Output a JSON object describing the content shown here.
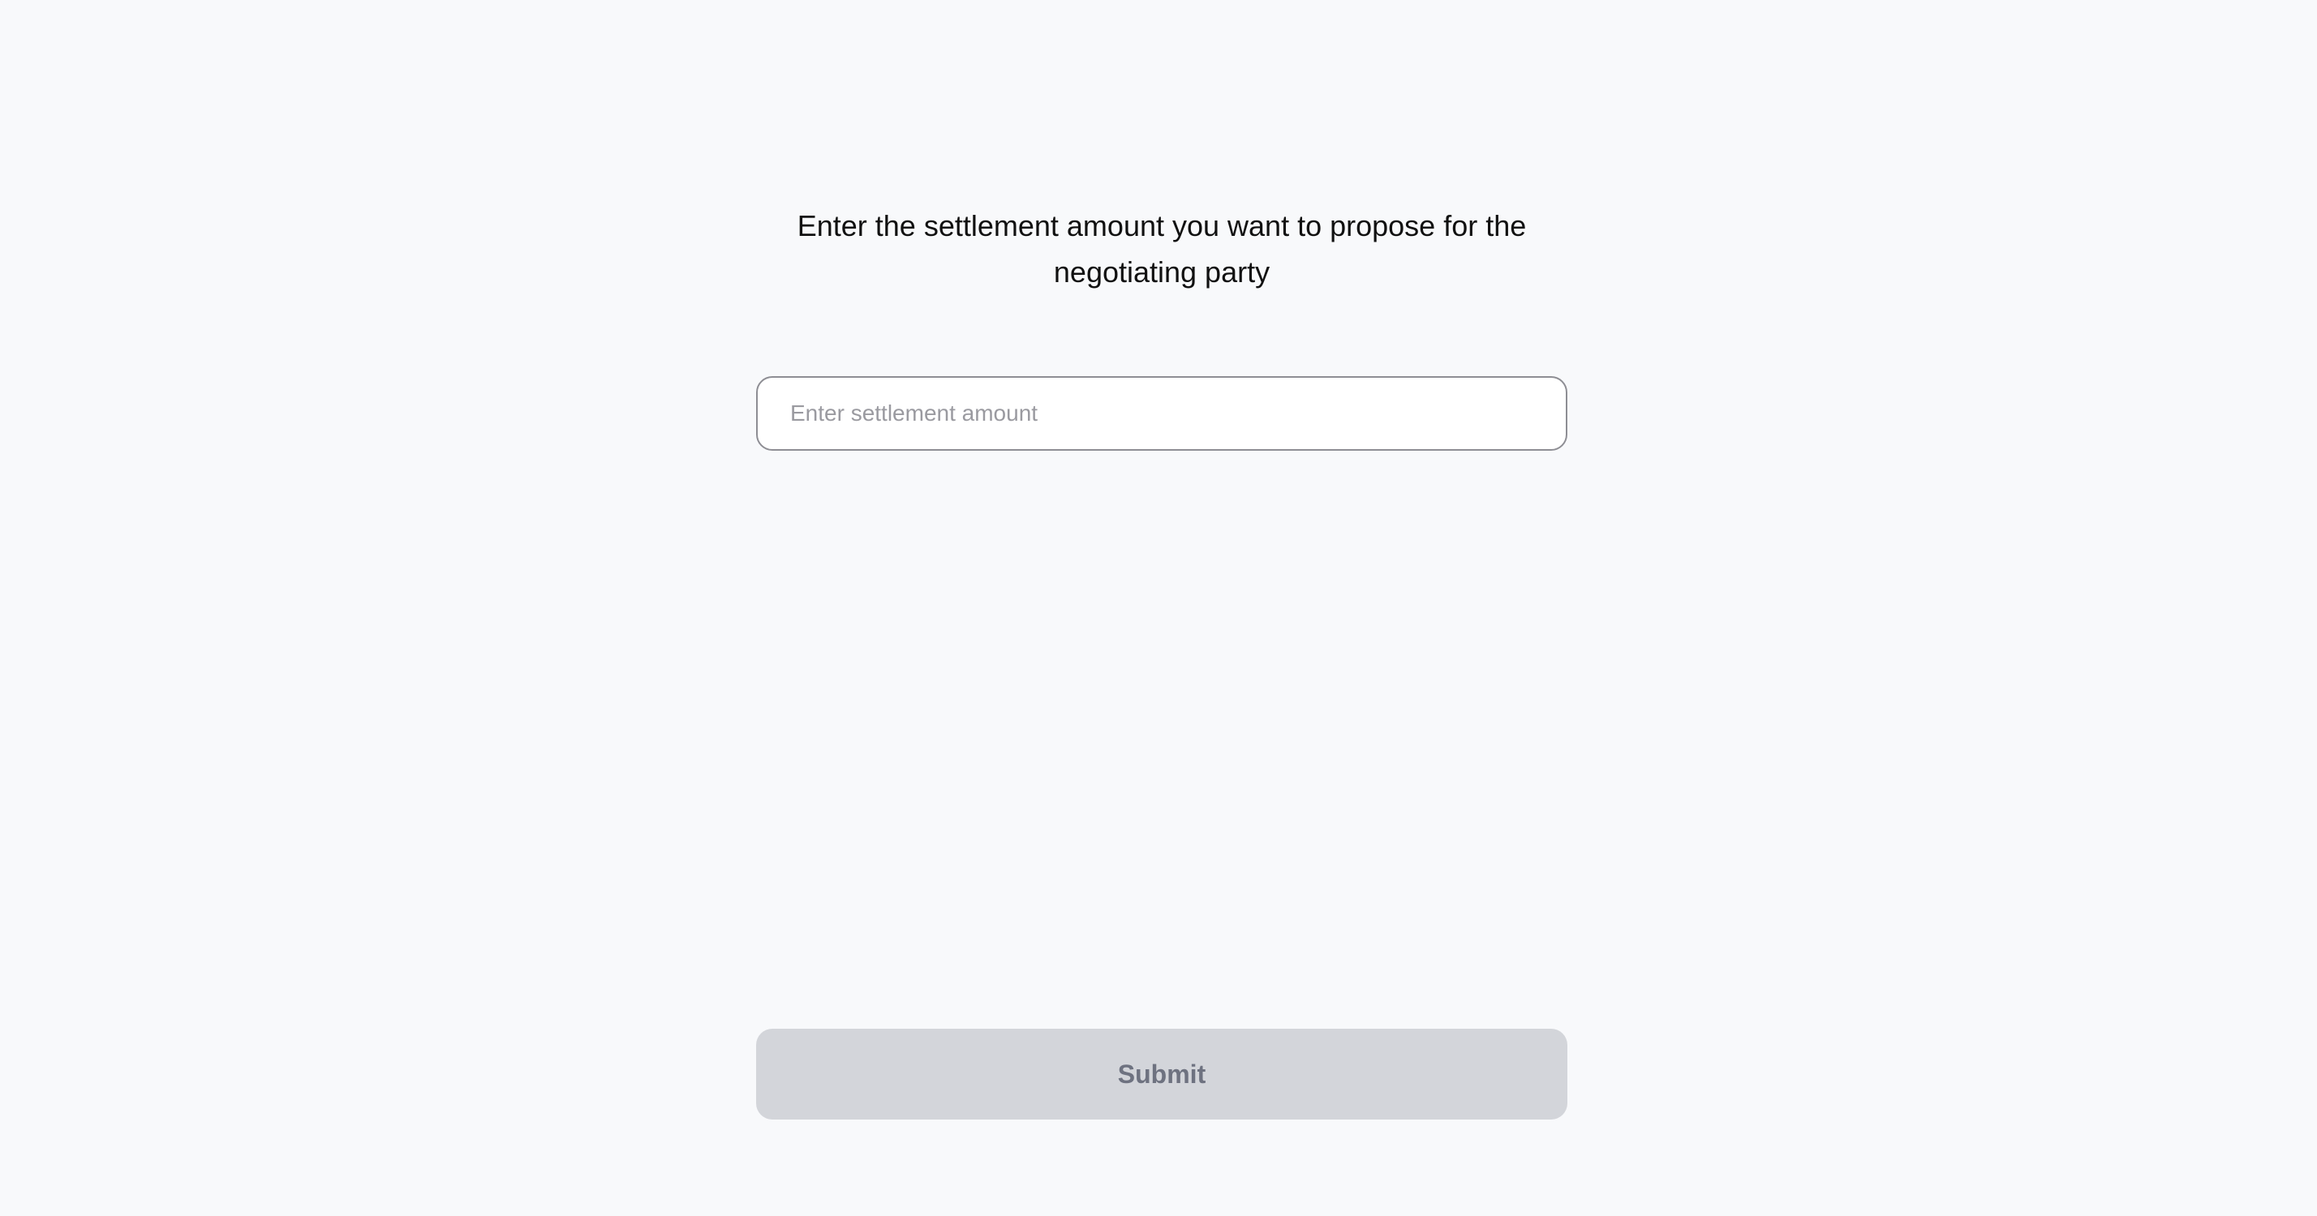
{
  "prompt": {
    "text": "Enter the settlement amount you want to propose for the negotiating party"
  },
  "amount_input": {
    "value": "",
    "placeholder": "Enter settlement amount"
  },
  "submit": {
    "label": "Submit",
    "state": "disabled"
  },
  "colors": {
    "background": "#f8f9fb",
    "button_disabled_bg": "#d3d5da",
    "button_disabled_text": "#6e7280"
  }
}
